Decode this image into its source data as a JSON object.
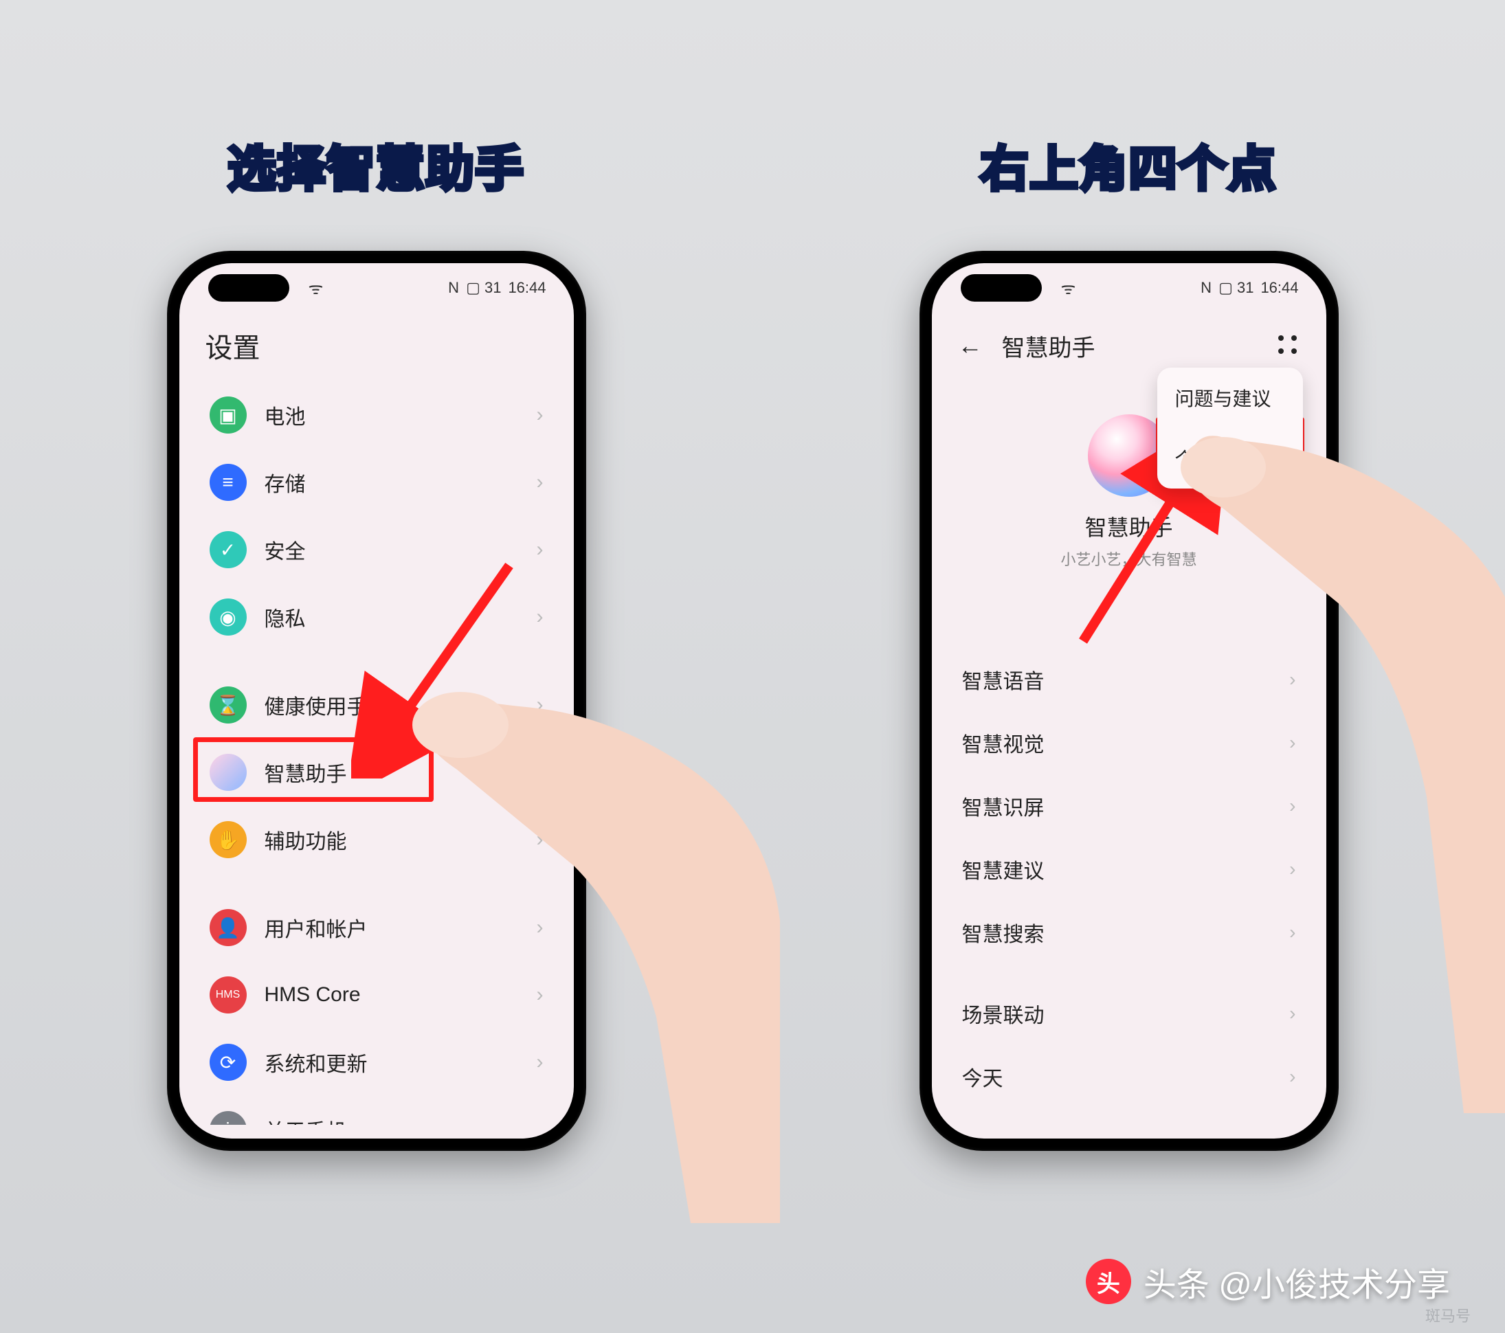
{
  "captions": {
    "left": "选择智慧助手",
    "right": "右上角四个点"
  },
  "status": {
    "signal_icon": "📶",
    "nfc": "N",
    "battery": "🔋 31",
    "time": "16:44"
  },
  "left_screen": {
    "title": "设置",
    "groups": [
      [
        {
          "name": "battery",
          "label": "电池",
          "color": "#32b96f",
          "glyph": "▢"
        },
        {
          "name": "storage",
          "label": "存储",
          "color": "#2f6bff",
          "glyph": "≡"
        },
        {
          "name": "security",
          "label": "安全",
          "color": "#2fc9b8",
          "glyph": "✓"
        },
        {
          "name": "privacy",
          "label": "隐私",
          "color": "#2fc9b8",
          "glyph": "◉"
        }
      ],
      [
        {
          "name": "digital-balance",
          "label": "健康使用手机",
          "color": "#2fb970",
          "glyph": "⌛"
        },
        {
          "name": "assistant",
          "label": "智慧助手",
          "color": "linear-gradient(135deg,#ffd3e6,#8fb8ff)",
          "glyph": ""
        },
        {
          "name": "accessibility",
          "label": "辅助功能",
          "color": "#f6a623",
          "glyph": "✋"
        }
      ],
      [
        {
          "name": "users",
          "label": "用户和帐户",
          "color": "#e74045",
          "glyph": "👤"
        },
        {
          "name": "hms-core",
          "label": "HMS Core",
          "color": "#e74045",
          "glyph": "HMS"
        },
        {
          "name": "system-update",
          "label": "系统和更新",
          "color": "#2f6bff",
          "glyph": "⟳"
        },
        {
          "name": "about",
          "label": "关于手机",
          "color": "#7a7e86",
          "glyph": "ℹ"
        }
      ]
    ]
  },
  "right_screen": {
    "title": "智慧助手",
    "center_name": "智慧助手",
    "center_sub": "小艺小艺，大有智慧",
    "popup": [
      "问题与建议",
      "个性化设置"
    ],
    "list_group_a": [
      "智慧语音",
      "智慧视觉",
      "智慧识屏",
      "智慧建议",
      "智慧搜索"
    ],
    "list_group_b": [
      "场景联动",
      "今天"
    ]
  },
  "watermark": {
    "logo_text": "头",
    "main": "头条 @小俊技术分享",
    "sub": "斑马号"
  }
}
